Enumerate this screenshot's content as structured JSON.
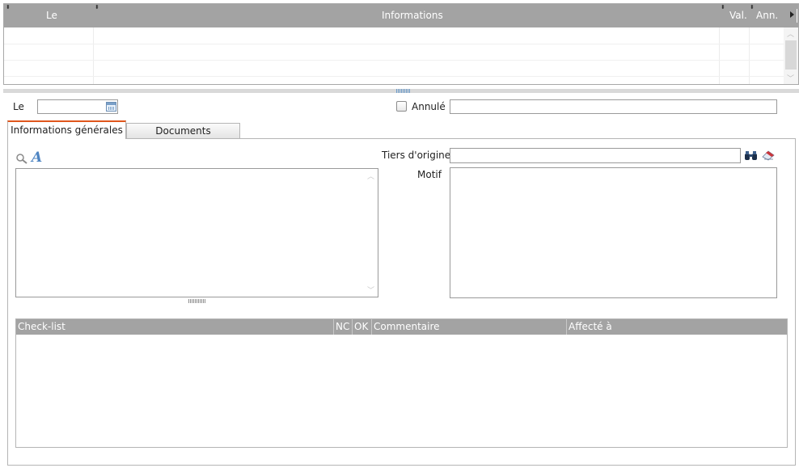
{
  "top_grid": {
    "columns": {
      "le": "Le",
      "informations": "Informations",
      "val": "Val.",
      "ann": "Ann."
    }
  },
  "form": {
    "le_label": "Le",
    "le_value": "",
    "annule_label": "Annulé",
    "annule_checked": false,
    "annule_value": ""
  },
  "tabs": {
    "general": "Informations générales",
    "documents": "Documents"
  },
  "general": {
    "main_text": "",
    "tiers_label": "Tiers d'origine",
    "tiers_value": "",
    "motif_label": "Motif",
    "motif_value": ""
  },
  "checklist": {
    "columns": {
      "checklist": "Check-list",
      "nc": "NC",
      "ok": "OK",
      "commentaire": "Commentaire",
      "affecte": "Affecté à"
    },
    "rows": []
  },
  "icons": {
    "search": "search-icon",
    "font": "font-style-icon",
    "calendar": "calendar-icon",
    "binoculars": "binoculars-icon",
    "eraser": "eraser-icon"
  },
  "colors": {
    "header_bg": "#a3a3a3",
    "active_tab_accent": "#e0561c",
    "accent_blue": "#4e84c2"
  }
}
